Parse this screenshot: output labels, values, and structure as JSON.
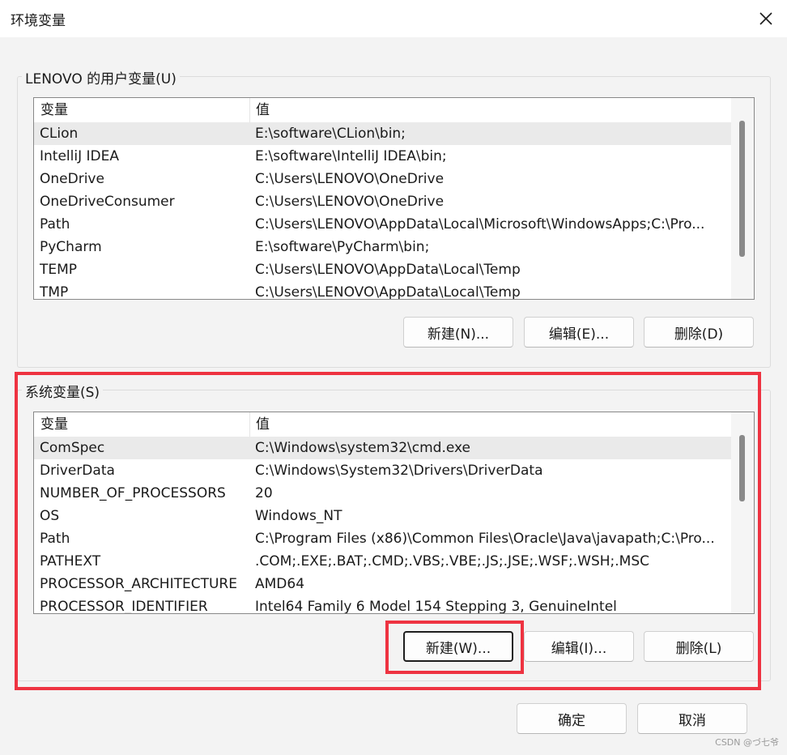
{
  "window": {
    "title": "环境变量",
    "close_icon": "close-icon"
  },
  "user_vars": {
    "label": "LENOVO 的用户变量(U)",
    "columns": [
      "变量",
      "值"
    ],
    "rows": [
      {
        "name": "CLion",
        "value": "E:\\software\\CLion\\bin;"
      },
      {
        "name": "IntelliJ IDEA",
        "value": "E:\\software\\IntelliJ IDEA\\bin;"
      },
      {
        "name": "OneDrive",
        "value": "C:\\Users\\LENOVO\\OneDrive"
      },
      {
        "name": "OneDriveConsumer",
        "value": "C:\\Users\\LENOVO\\OneDrive"
      },
      {
        "name": "Path",
        "value": "C:\\Users\\LENOVO\\AppData\\Local\\Microsoft\\WindowsApps;C:\\Pro..."
      },
      {
        "name": "PyCharm",
        "value": "E:\\software\\PyCharm\\bin;"
      },
      {
        "name": "TEMP",
        "value": "C:\\Users\\LENOVO\\AppData\\Local\\Temp"
      },
      {
        "name": "TMP",
        "value": "C:\\Users\\LENOVO\\AppData\\Local\\Temp"
      }
    ],
    "buttons": {
      "new": "新建(N)...",
      "edit": "编辑(E)...",
      "delete": "删除(D)"
    }
  },
  "system_vars": {
    "label": "系统变量(S)",
    "columns": [
      "变量",
      "值"
    ],
    "rows": [
      {
        "name": "ComSpec",
        "value": "C:\\Windows\\system32\\cmd.exe"
      },
      {
        "name": "DriverData",
        "value": "C:\\Windows\\System32\\Drivers\\DriverData"
      },
      {
        "name": "NUMBER_OF_PROCESSORS",
        "value": "20"
      },
      {
        "name": "OS",
        "value": "Windows_NT"
      },
      {
        "name": "Path",
        "value": "C:\\Program Files (x86)\\Common Files\\Oracle\\Java\\javapath;C:\\Pro..."
      },
      {
        "name": "PATHEXT",
        "value": ".COM;.EXE;.BAT;.CMD;.VBS;.VBE;.JS;.JSE;.WSF;.WSH;.MSC"
      },
      {
        "name": "PROCESSOR_ARCHITECTURE",
        "value": "AMD64"
      },
      {
        "name": "PROCESSOR_IDENTIFIER",
        "value": "Intel64 Family 6 Model 154 Stepping 3, GenuineIntel"
      }
    ],
    "buttons": {
      "new": "新建(W)...",
      "edit": "编辑(I)...",
      "delete": "删除(L)"
    }
  },
  "footer": {
    "ok": "确定",
    "cancel": "取消"
  },
  "watermark": "CSDN @づ七爷",
  "colors": {
    "highlight": "#ee3341",
    "selected_row": "#eaeaea"
  }
}
